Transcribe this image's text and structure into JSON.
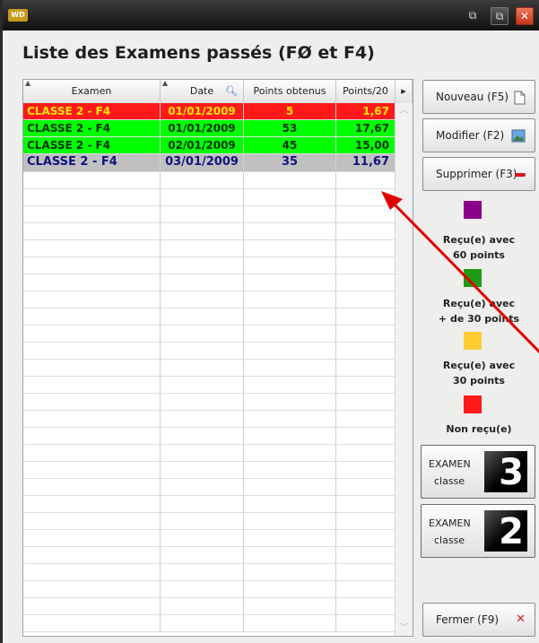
{
  "window": {
    "app_icon": "WD",
    "buttons": {
      "restore_a": "⧉",
      "restore_b": "⧉",
      "close": "✕"
    }
  },
  "page": {
    "title": "Liste des Examens passés (FØ et F4)"
  },
  "table": {
    "columns": [
      "Examen",
      "Date",
      "Points obtenus",
      "Points/20"
    ],
    "rows": [
      {
        "examen": "CLASSE 2 - F4",
        "date": "01/01/2009",
        "points": "5",
        "points20": "1,67",
        "color": "#ff1a1a"
      },
      {
        "examen": "CLASSE 2 - F4",
        "date": "01/01/2009",
        "points": "53",
        "points20": "17,67",
        "color": "#00ff00"
      },
      {
        "examen": "CLASSE 2 - F4",
        "date": "02/01/2009",
        "points": "45",
        "points20": "15,00",
        "color": "#00ff00"
      },
      {
        "examen": "CLASSE 2 - F4",
        "date": "03/01/2009",
        "points": "35",
        "points20": "11,67",
        "color": "#c0c0c0"
      }
    ]
  },
  "actions": {
    "new": "Nouveau (F5)",
    "edit": "Modifier (F2)",
    "delete": "Supprimer (F3)",
    "close": "Fermer (F9)"
  },
  "legend": [
    {
      "color": "#8b008b",
      "line1": "Reçu(e) avec",
      "line2": "60 points"
    },
    {
      "color": "#1f9a14",
      "line1": "Reçu(e) avec",
      "line2": "+ de 30 points"
    },
    {
      "color": "#ffcc33",
      "line1": "Reçu(e) avec",
      "line2": "30 points"
    },
    {
      "color": "#ff1a1a",
      "line1": "Non reçu(e)",
      "line2": ""
    }
  ],
  "exam_buttons": [
    {
      "word": "EXAMEN",
      "sub": "classe",
      "number": "3"
    },
    {
      "word": "EXAMEN",
      "sub": "classe",
      "number": "2"
    }
  ],
  "icons": {
    "new": "document-icon",
    "edit": "image-icon",
    "delete": "minus-icon",
    "close": "close-icon",
    "sort": "sort-icon",
    "search": "search-icon"
  }
}
